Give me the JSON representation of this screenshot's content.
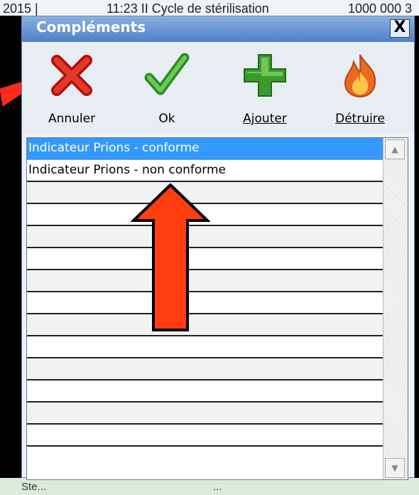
{
  "background": {
    "top_fragments": [
      "2015 |",
      "11:23 II Cycle de stérilisation",
      "1000 000 3"
    ],
    "bottom_fragments": [
      "Ste...",
      "..."
    ]
  },
  "dialog": {
    "title": "Compléments",
    "close_label": "X",
    "toolbar": {
      "cancel_label": "Annuler",
      "ok_label": "Ok",
      "add_label": "Ajouter",
      "destroy_label": "Détruire"
    },
    "list": {
      "items": [
        "Indicateur Prions - conforme",
        "Indicateur Prions - non conforme",
        "",
        "",
        "",
        "",
        "",
        "",
        "",
        "",
        "",
        "",
        "",
        ""
      ],
      "selected_index": 0
    }
  },
  "colors": {
    "selection": "#3399ff",
    "title_bar": "#4f80c8",
    "annotation_arrow": "#ff3300"
  }
}
